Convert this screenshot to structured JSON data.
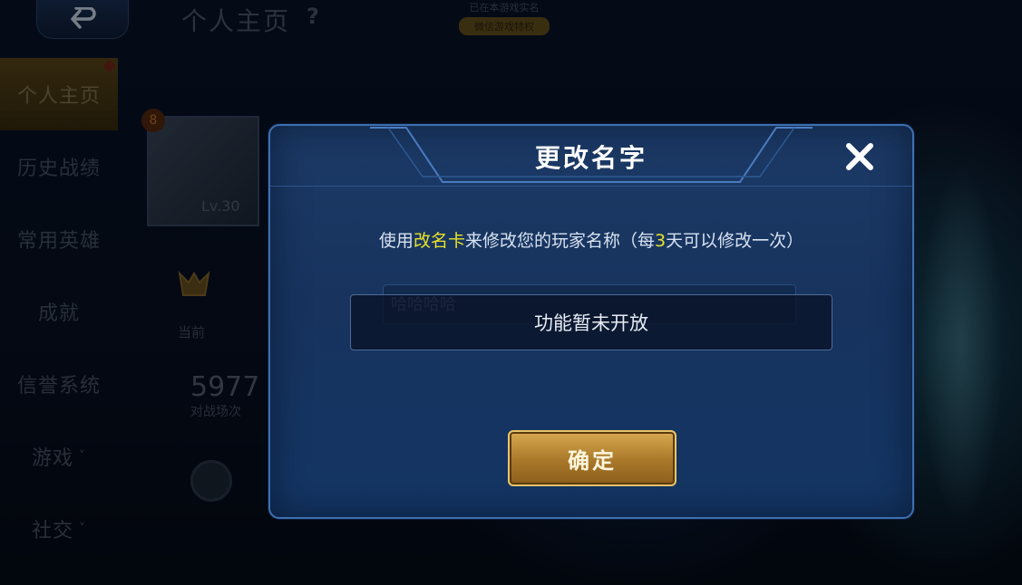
{
  "topbar": {
    "back_icon": "back-arrow-icon",
    "page_title": "个人主页",
    "help": "?",
    "banner_line1": "已在本游戏实名",
    "banner_pill": "微信游戏特权"
  },
  "sidebar": {
    "items": [
      {
        "label": "个人主页",
        "active": true
      },
      {
        "label": "历史战绩"
      },
      {
        "label": "常用英雄"
      },
      {
        "label": "成就"
      },
      {
        "label": "信誉系统"
      },
      {
        "label": "游戏",
        "chevron": "˅"
      },
      {
        "label": "社交",
        "chevron": "˅"
      }
    ]
  },
  "profile": {
    "level_badge": "8",
    "avatar_level": "Lv.30",
    "current_label": "当前",
    "battles_value": "5977",
    "battles_label": "对战场次"
  },
  "dialog": {
    "title": "更改名字",
    "desc_prefix": "使用",
    "desc_card": "改名卡",
    "desc_mid": "来修改您的玩家名称（每",
    "desc_days": "3",
    "desc_suffix": "天可以修改一次）",
    "input_value": "哈哈哈哈",
    "notice": "功能暂未开放",
    "confirm_label": "确定",
    "close_icon": "close-icon"
  },
  "colors": {
    "dialog_bg": "#17335e",
    "dialog_border": "#3d6fb0",
    "highlight": "#e8e32a",
    "confirm_gold": "#d9aa50"
  }
}
